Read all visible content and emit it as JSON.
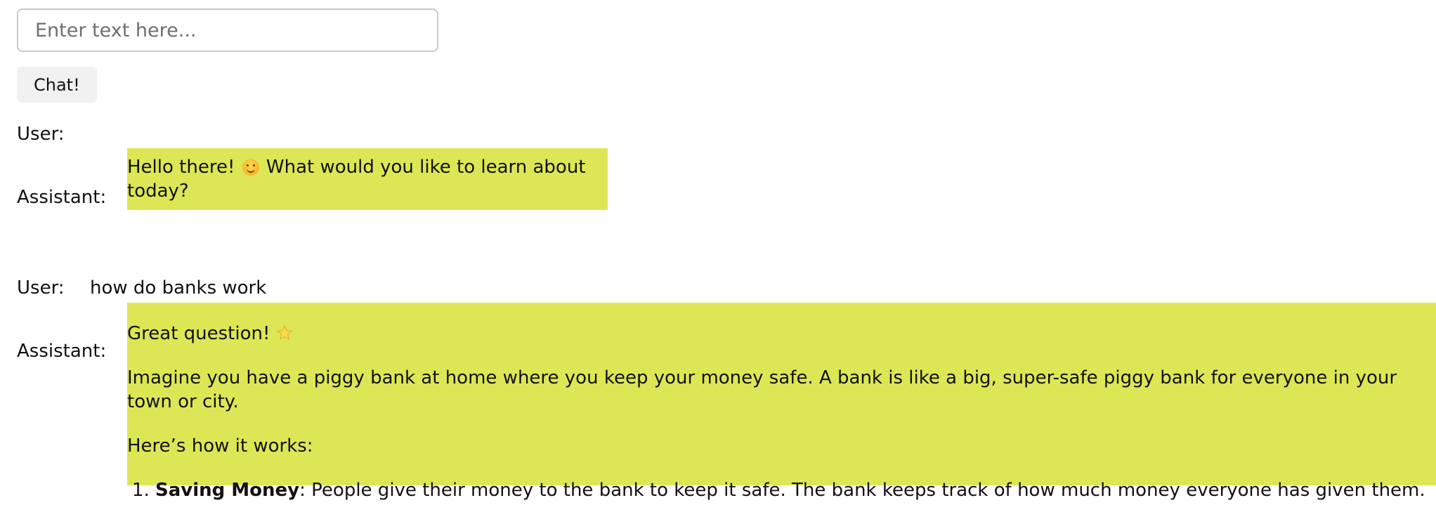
{
  "input": {
    "placeholder": "Enter text here...",
    "value": ""
  },
  "chat_button": {
    "label": "Chat!"
  },
  "colors": {
    "assistant_bubble": "#dde755",
    "button_bg": "#f1f1f1",
    "input_border": "#c9c9c9"
  },
  "messages": [
    {
      "role": "User:",
      "text": ""
    },
    {
      "role": "Assistant:",
      "text_before": "Hello there!",
      "emoji": "smiling-face-icon",
      "text_after": "What would you like to learn about today?"
    },
    {
      "role": "User:",
      "text": "how do banks work"
    },
    {
      "role": "Assistant:",
      "intro": "Great question!",
      "intro_emoji": "star-icon",
      "paragraph1": "Imagine you have a piggy bank at home where you keep your money safe. A bank is like a big, super-safe piggy bank for everyone in your town or city.",
      "paragraph2": "Here’s how it works:",
      "list": [
        {
          "number": "1.",
          "bold": "Saving Money",
          "text": ": People give their money to the bank to keep it safe. The bank keeps track of how much money everyone has given them."
        }
      ]
    }
  ]
}
